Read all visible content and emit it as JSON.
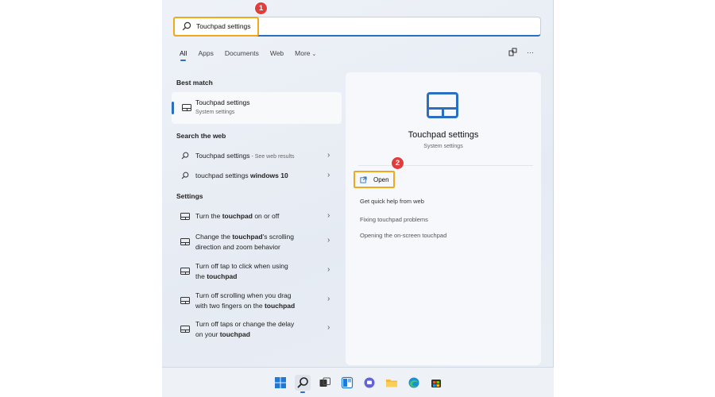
{
  "search": {
    "query": "Touchpad settings",
    "badge": "1"
  },
  "tabs": [
    "All",
    "Apps",
    "Documents",
    "Web",
    "More"
  ],
  "toolbar": {
    "share_icon": "share-icon",
    "more_label": "···"
  },
  "best_match": {
    "heading": "Best match",
    "title": "Touchpad settings",
    "subtitle": "System settings"
  },
  "web": {
    "heading": "Search the web",
    "items": [
      {
        "text": "Touchpad settings",
        "suffix": " - See web results"
      },
      {
        "text": "touchpad settings ",
        "bold": "windows 10"
      }
    ]
  },
  "settings": {
    "heading": "Settings",
    "items": [
      {
        "pre": "Turn the ",
        "bold": "touchpad",
        "post": " on or off",
        "line2": ""
      },
      {
        "pre": "Change the ",
        "bold": "touchpad",
        "post": "'s scrolling",
        "line2": "direction and zoom behavior"
      },
      {
        "pre": "Turn off tap to click when using",
        "bold": "",
        "post": "",
        "line2_pre": "the ",
        "line2_bold": "touchpad"
      },
      {
        "pre": "Turn off scrolling when you drag",
        "bold": "",
        "post": "",
        "line2_pre": "with two fingers on the ",
        "line2_bold": "touchpad"
      },
      {
        "pre": "Turn off taps or change the delay",
        "bold": "",
        "post": "",
        "line2_pre": "on your ",
        "line2_bold": "touchpad"
      }
    ]
  },
  "detail": {
    "title": "Touchpad settings",
    "subtitle": "System settings",
    "open_label": "Open",
    "badge": "2",
    "quick_help": "Get quick help from web",
    "links": [
      "Fixing touchpad problems",
      "Opening the on-screen touchpad"
    ]
  },
  "colors": {
    "accent": "#2b6fc2",
    "highlight": "#f0a81c",
    "badge": "#e23d3d"
  },
  "taskbar": {
    "icons": [
      "windows-start-icon",
      "search-icon",
      "task-view-icon",
      "widgets-icon",
      "chat-icon",
      "file-explorer-icon",
      "edge-browser-icon",
      "store-icon"
    ]
  }
}
